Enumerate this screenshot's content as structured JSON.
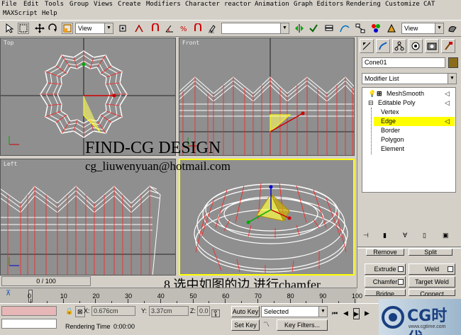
{
  "menu": [
    "File",
    "Edit",
    "Tools",
    "Group",
    "Views",
    "Create",
    "Modifiers",
    "Character",
    "reactor",
    "Animation",
    "Graph Editors",
    "Rendering",
    "Customize",
    "CAT",
    "MAXScript",
    "Help"
  ],
  "toolbar": {
    "view_dropdown": "View",
    "selection_dropdown": "",
    "view_dropdown_right": "View"
  },
  "viewports": {
    "top": "Top",
    "front": "Front",
    "left": "Left",
    "perspective": ""
  },
  "overlay": {
    "watermark": "FIND-CG DESIGN",
    "email": "cg_liuwenyuan@hotmail.com",
    "caption": "8.选中如图的边,进行chamfer"
  },
  "command_panel": {
    "object_name": "Cone01",
    "object_color": "#8a6d1a",
    "modifier_list": "Modifier List",
    "stack": {
      "modifier": "MeshSmooth",
      "base": "Editable Poly",
      "subobjects": [
        "Vertex",
        "Edge",
        "Border",
        "Polygon",
        "Element"
      ],
      "selected": "Edge"
    },
    "rollout_partial": [
      "Remove",
      "Split"
    ],
    "buttons": [
      {
        "label": "Extrude"
      },
      {
        "label": "Weld"
      },
      {
        "label": "Chamfer"
      },
      {
        "label": "Target Weld"
      },
      {
        "label": "Bridge"
      },
      {
        "label": "Connect"
      }
    ]
  },
  "timeline": {
    "slider_label": "0 / 100",
    "ticks": [
      "0",
      "10",
      "20",
      "30",
      "40",
      "50",
      "60",
      "70",
      "80",
      "90",
      "100"
    ]
  },
  "status": {
    "x_label": "X:",
    "x_value": "0.676cm",
    "y_label": "Y:",
    "y_value": "3.37cm",
    "z_label": "Z:",
    "z_value": "0.0",
    "auto_key": "Auto Key",
    "set_key": "Set Key",
    "selected_dropdown": "Selected",
    "key_filters": "Key Filters...",
    "rendering_time_label": "Rendering Time",
    "rendering_time": "0:00:00"
  },
  "logo": {
    "text": "CG时代",
    "subtext": "www.cgtime.com"
  },
  "colors": {
    "bg": "#d4d0c8",
    "viewport": "#8f8f8f",
    "active_border": "#ffff00",
    "wire_white": "#ffffff",
    "wire_red": "#ff2020",
    "selection": "#ffff00"
  }
}
